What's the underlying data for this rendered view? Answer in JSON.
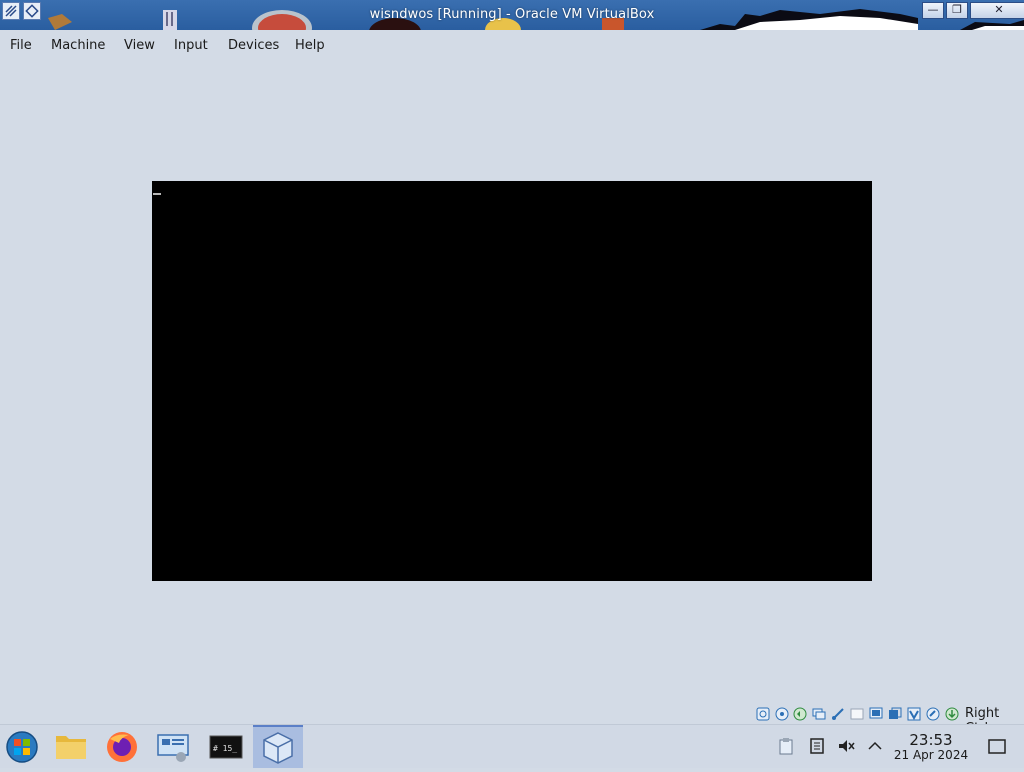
{
  "window": {
    "title": "wisndwos [Running] - Oracle VM VirtualBox",
    "minimize_glyph": "—",
    "maximize_glyph": "❐",
    "close_glyph": "✕"
  },
  "menu": {
    "items": [
      {
        "label": "File"
      },
      {
        "label": "Machine"
      },
      {
        "label": "View"
      },
      {
        "label": "Input"
      },
      {
        "label": "Devices"
      },
      {
        "label": "Help"
      }
    ]
  },
  "vm": {
    "status": "Running",
    "screen_color": "#000000"
  },
  "statusbar": {
    "host_key": "Right Ctrl",
    "indicators": [
      "hard-disk-icon",
      "optical-drive-icon",
      "audio-icon",
      "network-icon",
      "usb-icon",
      "shared-folders-icon",
      "display-icon",
      "recording-icon",
      "virtualization-icon",
      "mouse-integration-icon",
      "keyboard-icon"
    ]
  },
  "taskbar": {
    "apps": [
      {
        "name": "start-menu-icon"
      },
      {
        "name": "file-manager-icon"
      },
      {
        "name": "firefox-icon"
      },
      {
        "name": "system-settings-icon"
      },
      {
        "name": "terminal-icon",
        "text": "# 15_"
      },
      {
        "name": "virtualbox-icon",
        "active": true
      }
    ],
    "tray": [
      "clipboard-icon",
      "notes-icon",
      "volume-muted-icon",
      "chevron-up-icon"
    ],
    "clock": {
      "time": "23:53",
      "date": "21 Apr 2024"
    },
    "show_desktop": "show-desktop-icon"
  },
  "colors": {
    "desktop_bg": "#d3dbe6",
    "titlebar": "#2f63a8",
    "accent": "#5b7fc7",
    "vm_screen": "#000000"
  }
}
